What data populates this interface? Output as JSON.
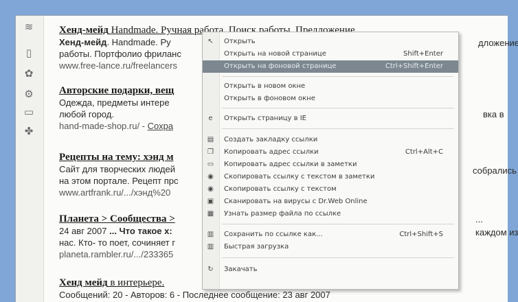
{
  "sidebar": {
    "icons": [
      "scroll-icon",
      "page-icon",
      "flower-icon",
      "gear-icon",
      "window-icon",
      "bug-icon"
    ]
  },
  "results": [
    {
      "title_bold": "Хенд-мейд",
      "title_rest": " Handmade. Ручная работа. Поиск работы. Предложение",
      "line1_bold": "Хенд-мейд",
      "line1_rest": ". Handmade. Ру",
      "line2": "работы. Портфолио фриланс",
      "url": "www.free-lance.ru/freelancers",
      "right": "дложение"
    },
    {
      "title_bold": "Авторские подарки, вещ",
      "line1": "Одежда, предметы интере",
      "line2": "любой город.",
      "url": "hand-made-shop.ru/ - ",
      "url_link": "Сохра",
      "right": "вка в"
    },
    {
      "title_bold": "Рецепты на тему: хэнд м",
      "line1": "Сайт для творческих людей",
      "line2": "на этом портале. Рецепт прс",
      "url": "www.artfrank.ru/.../хэнд%20",
      "right": "собрались"
    },
    {
      "title_bold": "Планета > Сообщества >",
      "line1_pre": "24 авг 2007 ",
      "line1_bold": "... Что такое х:",
      "line2": "нас. Кто- то поет, сочиняет г",
      "url": "planeta.rambler.ru/.../233365",
      "right": "каждом из",
      "right_dots": "..."
    },
    {
      "title_bold": "Хенд мейд",
      "title_rest": " в интерьере.",
      "line1": "Сообщений: 20 - Авторов: 6 - Последнее сообщение: 23 авг 2007"
    }
  ],
  "context_menu": {
    "items": [
      {
        "label": "Открыть",
        "shortcut": "",
        "icon": "cursor-icon"
      },
      {
        "label": "Открыть на новой странице",
        "shortcut": "Shift+Enter",
        "icon": ""
      },
      {
        "label": "Открыть на фоновой странице",
        "shortcut": "Ctrl+Shift+Enter",
        "icon": "",
        "highlighted": true
      },
      {
        "label": "Открыть в новом окне",
        "shortcut": "",
        "icon": ""
      },
      {
        "label": "Открыть в фоновом окне",
        "shortcut": "",
        "icon": ""
      },
      {
        "label": "Открыть страницу в IE",
        "shortcut": "",
        "icon": "ie-icon"
      },
      {
        "label": "Создать закладку ссылки",
        "shortcut": "",
        "icon": "bookmark-icon"
      },
      {
        "label": "Копировать адрес ссылки",
        "shortcut": "Ctrl+Alt+C",
        "icon": "copy-icon"
      },
      {
        "label": "Копировать адрес ссылки в заметки",
        "shortcut": "",
        "icon": "notes-icon"
      },
      {
        "label": "Скопировать ссылку с текстом в заметки",
        "shortcut": "",
        "icon": "notes-text-icon"
      },
      {
        "label": "Скопировать ссылку с текстом",
        "shortcut": "",
        "icon": "copy-text-icon"
      },
      {
        "label": "Сканировать на вирусы с Dr.Web Online",
        "shortcut": "",
        "icon": "drweb-icon"
      },
      {
        "label": "Узнать размер файла по ссылке",
        "shortcut": "",
        "icon": "filesize-icon"
      },
      {
        "label": "Сохранить по ссылке как...",
        "shortcut": "Ctrl+Shift+S",
        "icon": "save-icon"
      },
      {
        "label": "Быстрая загрузка",
        "shortcut": "",
        "icon": "download-icon"
      },
      {
        "label": "Закачать",
        "shortcut": "",
        "icon": "fetch-icon"
      }
    ]
  }
}
